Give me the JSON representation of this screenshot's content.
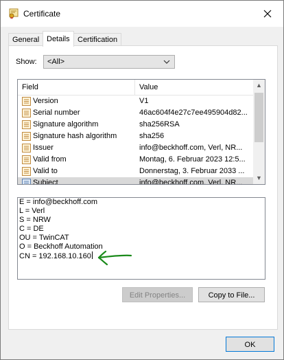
{
  "window": {
    "title": "Certificate",
    "icon": "certificate-icon"
  },
  "tabs": [
    {
      "label": "General"
    },
    {
      "label": "Details",
      "active": true
    },
    {
      "label": "Certification Path"
    }
  ],
  "show": {
    "label": "Show:",
    "value": "<All>"
  },
  "columns": {
    "field": "Field",
    "value": "Value"
  },
  "rows": [
    {
      "field": "Version",
      "value": "V1"
    },
    {
      "field": "Serial number",
      "value": "46ac604f4e27c7ee495904d82..."
    },
    {
      "field": "Signature algorithm",
      "value": "sha256RSA"
    },
    {
      "field": "Signature hash algorithm",
      "value": "sha256"
    },
    {
      "field": "Issuer",
      "value": "info@beckhoff.com, Verl, NR..."
    },
    {
      "field": "Valid from",
      "value": "Montag, 6. Februar 2023 12:5..."
    },
    {
      "field": "Valid to",
      "value": "Donnerstag, 3. Februar 2033 ..."
    },
    {
      "field": "Subject",
      "value": "info@beckhoff.com, Verl, NR...",
      "selected": true
    }
  ],
  "detail_lines": [
    "E = info@beckhoff.com",
    "L = Verl",
    "S = NRW",
    "C = DE",
    "OU = TwinCAT",
    "O = Beckhoff Automation",
    "CN = 192.168.10.160"
  ],
  "buttons": {
    "edit_properties": "Edit Properties...",
    "copy_to_file": "Copy to File...",
    "ok": "OK"
  },
  "colors": {
    "annotation_arrow": "#1a8a1a",
    "selected_row": "#d9d9d9",
    "ok_border": "#0078d7"
  }
}
